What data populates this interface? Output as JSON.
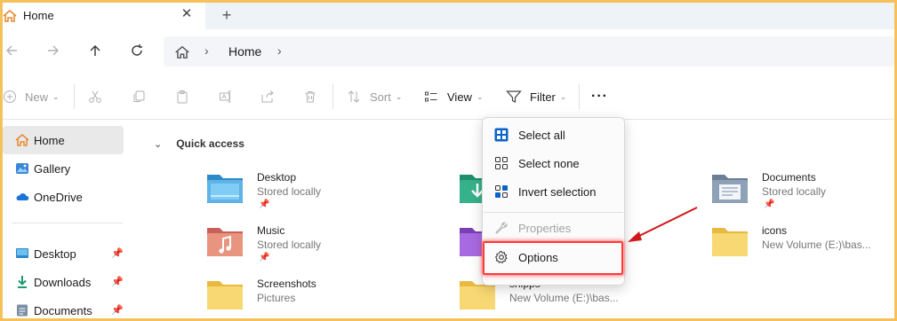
{
  "window": {
    "tab_title": "Home",
    "tab_close": "✕",
    "new_tab": "+"
  },
  "address": {
    "crumb": "Home",
    "separator": "›"
  },
  "toolbar": {
    "new_label": "New",
    "sort_label": "Sort",
    "view_label": "View",
    "filter_label": "Filter",
    "more_label": "···"
  },
  "sidebar": {
    "items": [
      {
        "label": "Home"
      },
      {
        "label": "Gallery"
      },
      {
        "label": "OneDrive"
      },
      {
        "label": "Desktop"
      },
      {
        "label": "Downloads"
      },
      {
        "label": "Documents"
      }
    ]
  },
  "main": {
    "section_title": "Quick access",
    "tiles": [
      {
        "name": "Desktop",
        "sub": "Stored locally"
      },
      {
        "name": "Documents",
        "sub": "Stored locally"
      },
      {
        "name": "Music",
        "sub": "Stored locally"
      },
      {
        "name": "icons",
        "sub": "New Volume (E:)\\bas..."
      },
      {
        "name": "Screenshots",
        "sub": "Pictures"
      },
      {
        "name": "snipps",
        "sub": "New Volume (E:)\\bas..."
      }
    ]
  },
  "menu": {
    "select_all": "Select all",
    "select_none": "Select none",
    "invert_selection": "Invert selection",
    "properties": "Properties",
    "options": "Options"
  },
  "colors": {
    "highlight": "#ff3b3b",
    "accent": "#0a64c8",
    "folder": "#f7d774",
    "frame": "#f6c15a"
  }
}
